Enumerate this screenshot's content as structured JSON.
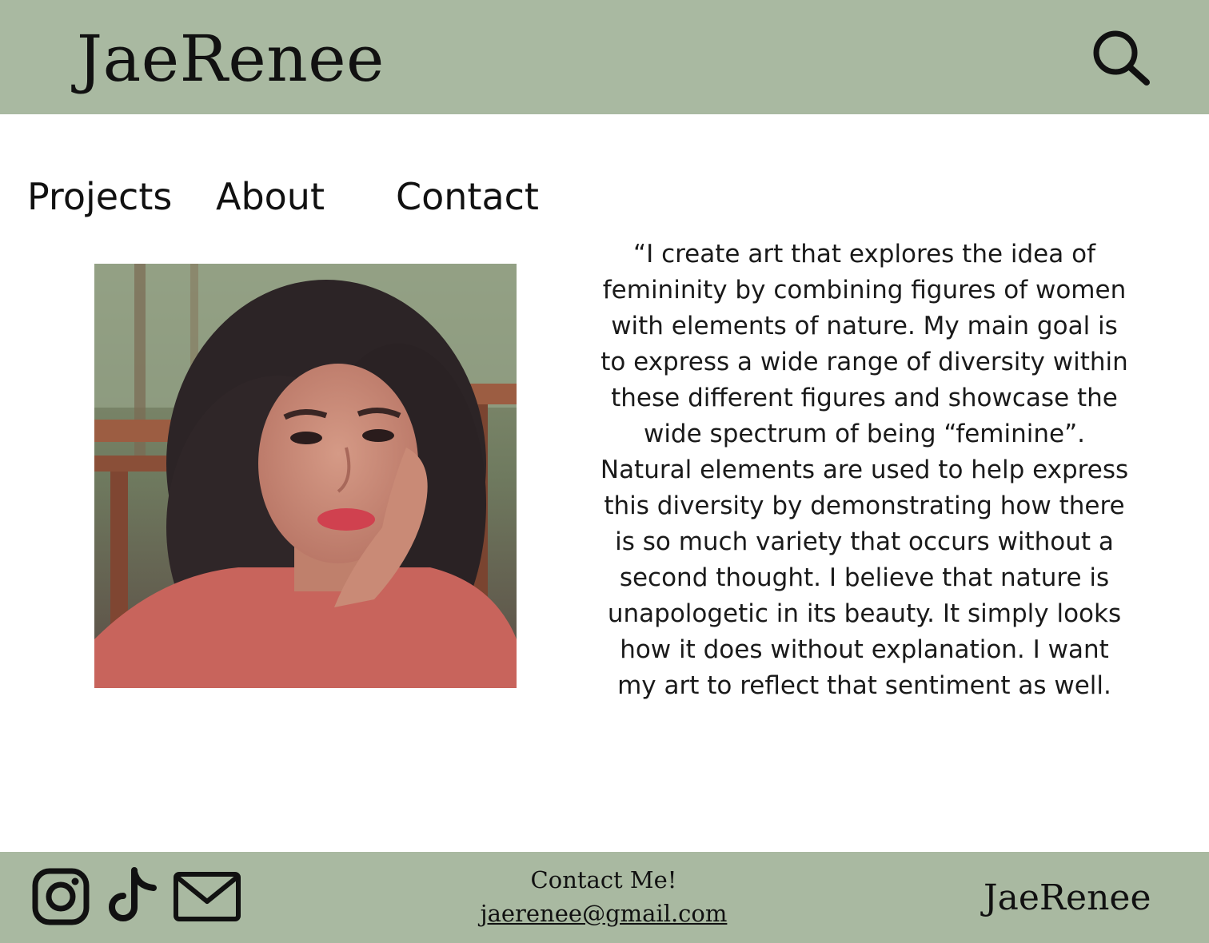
{
  "header": {
    "brand": "JaeRenee",
    "search_icon": "search-icon"
  },
  "nav": {
    "items": [
      {
        "label": "Projects"
      },
      {
        "label": "About"
      },
      {
        "label": "Contact"
      }
    ]
  },
  "about": {
    "statement": "“I create art that explores the idea of femininity by combining figures of women with elements of nature. My main goal is to express a wide range of diversity within these different figures and showcase the wide spectrum of being “feminine”. Natural elements are used to help express this diversity by demonstrating how there is so much variety that occurs without a second thought. I believe that nature is unapologetic in its beauty. It simply looks how it does without explanation. I want my art to reflect that sentiment as well."
  },
  "footer": {
    "social_icons": [
      "instagram-icon",
      "tiktok-icon",
      "mail-icon"
    ],
    "contact_title": "Contact Me!",
    "email": " jaerenee@gmail.com",
    "brand": "JaeRenee"
  },
  "colors": {
    "header_bg": "#a9b9a1",
    "footer_bg": "#a9b9a1",
    "text": "#111111"
  }
}
